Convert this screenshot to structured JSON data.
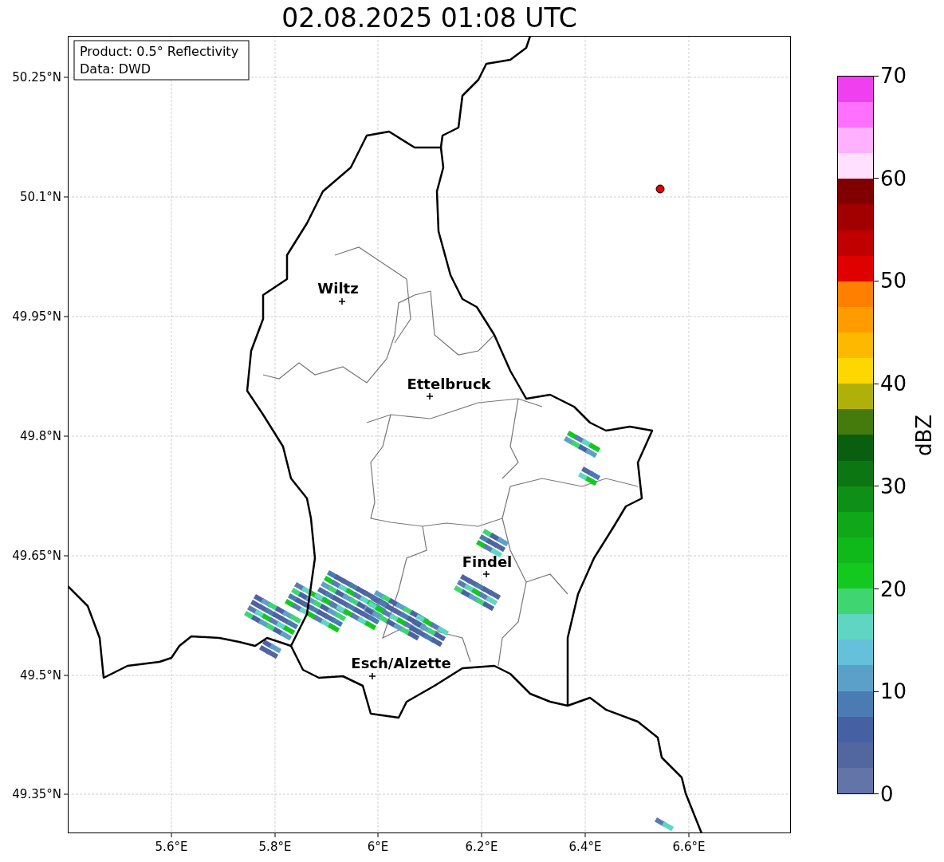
{
  "title": "02.08.2025 01:08 UTC",
  "info_box": [
    "Product: 0.5° Reflectivity",
    "Data: DWD"
  ],
  "cities": [
    {
      "name": "Wiltz"
    },
    {
      "name": "Ettelbruck"
    },
    {
      "name": "Findel"
    },
    {
      "name": "Esch/Alzette"
    }
  ],
  "x_ticks": [
    "5.6°E",
    "5.8°E",
    "6°E",
    "6.2°E",
    "6.4°E",
    "6.6°E"
  ],
  "y_ticks": [
    "50.25°N",
    "50.1°N",
    "49.95°N",
    "49.8°N",
    "49.65°N",
    "49.5°N",
    "49.35°N"
  ],
  "colorbar": {
    "label": "dBZ",
    "ticks": [
      "70",
      "60",
      "50",
      "40",
      "30",
      "20",
      "10",
      "0"
    ],
    "bins": [
      {
        "color": "#6374a8"
      },
      {
        "color": "#52679f"
      },
      {
        "color": "#4561a3"
      },
      {
        "color": "#4b7bb3"
      },
      {
        "color": "#5ba0c8"
      },
      {
        "color": "#65c0db"
      },
      {
        "color": "#5ed6c3"
      },
      {
        "color": "#3fd672"
      },
      {
        "color": "#13c91f"
      },
      {
        "color": "#10b91a"
      },
      {
        "color": "#10a818"
      },
      {
        "color": "#0e8f15"
      },
      {
        "color": "#0c7712"
      },
      {
        "color": "#0a5e10"
      },
      {
        "color": "#457a0c"
      },
      {
        "color": "#b0b00a"
      },
      {
        "color": "#ffd700"
      },
      {
        "color": "#ffb800"
      },
      {
        "color": "#ff9c00"
      },
      {
        "color": "#ff8000"
      },
      {
        "color": "#e00000"
      },
      {
        "color": "#c00000"
      },
      {
        "color": "#a00000"
      },
      {
        "color": "#800000"
      },
      {
        "color": "#ffe0ff"
      },
      {
        "color": "#ffb0ff"
      },
      {
        "color": "#ff70ff"
      },
      {
        "color": "#ee40ee"
      }
    ]
  }
}
